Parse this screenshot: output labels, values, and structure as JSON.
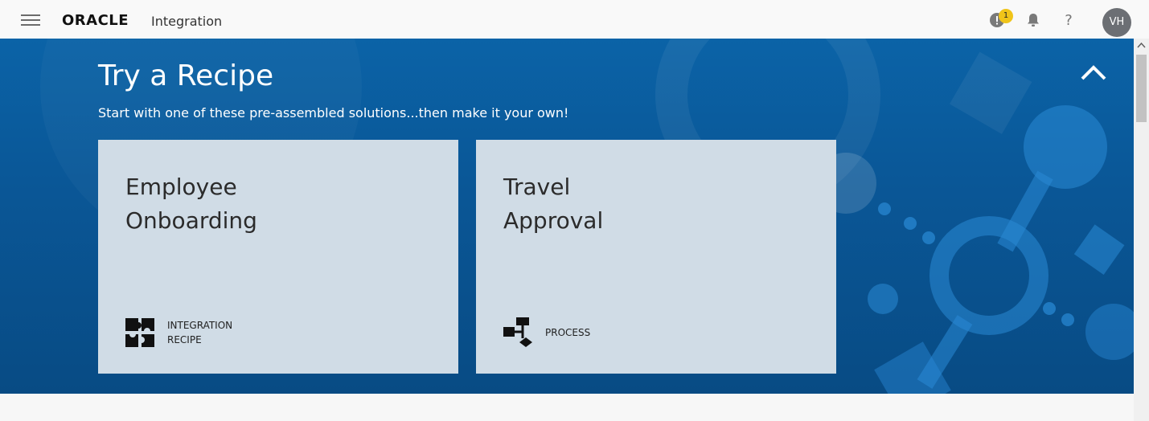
{
  "header": {
    "logo_text": "ORACLE",
    "product_name": "Integration",
    "notification_count": "1",
    "help_label": "?",
    "avatar_initials": "VH"
  },
  "hero": {
    "title": "Try a Recipe",
    "subtitle": "Start with one of these pre-assembled solutions...then make it your own!",
    "cards": [
      {
        "title": "Employee\nOnboarding",
        "type": "INTEGRATION\nRECIPE",
        "icon": "puzzle-icon"
      },
      {
        "title": "Travel\nApproval",
        "type": "PROCESS",
        "icon": "process-flow-icon"
      }
    ]
  },
  "colors": {
    "hero_blue": "#0a5797",
    "card_bg": "#d0dce6",
    "badge_yellow": "#f0c419",
    "avatar_gray": "#6c6f74"
  }
}
